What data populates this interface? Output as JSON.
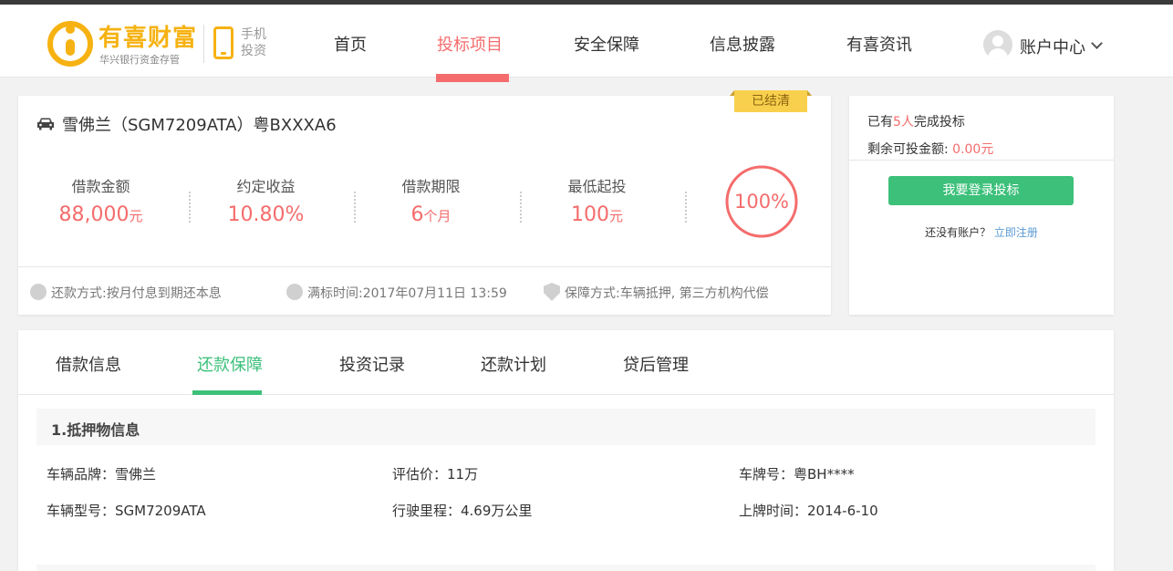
{
  "header": {
    "logo_name": "有喜财富",
    "logo_sub": "华兴银行资金存管",
    "mobile_line1": "手机",
    "mobile_line2": "投资",
    "nav": [
      {
        "label": "首页"
      },
      {
        "label": "投标项目"
      },
      {
        "label": "安全保障"
      },
      {
        "label": "信息披露"
      },
      {
        "label": "有喜资讯"
      }
    ],
    "account_label": "账户中心"
  },
  "project": {
    "title": "雪佛兰（SGM7209ATA）粤BXXXA6",
    "status": "已结清",
    "stats": [
      {
        "label": "借款金额",
        "value": "88,000",
        "unit": "元"
      },
      {
        "label": "约定收益",
        "value": "10.80%",
        "unit": ""
      },
      {
        "label": "借款期限",
        "value": "6",
        "unit": "个月"
      },
      {
        "label": "最低起投",
        "value": "100",
        "unit": "元"
      }
    ],
    "progress_text": "100%",
    "progress_fraction": 1.0,
    "footer": {
      "repay_method": "还款方式:按月付息到期还本息",
      "full_time": "满标时间:2017年07月11日 13:59",
      "guarantee": "保障方式:车辆抵押, 第三方机构代偿"
    }
  },
  "side": {
    "investors_prefix": "已有",
    "investors_count": "5人",
    "investors_suffix": "完成投标",
    "remaining_label": "剩余可投金额:",
    "remaining_value": "0.00元",
    "login_button": "我要登录投标",
    "no_account": "还没有账户？",
    "register_link": "立即注册"
  },
  "tabs": [
    {
      "label": "借款信息"
    },
    {
      "label": "还款保障"
    },
    {
      "label": "投资记录"
    },
    {
      "label": "还款计划"
    },
    {
      "label": "贷后管理"
    }
  ],
  "collateral": {
    "section_title": "1.抵押物信息",
    "brand": "车辆品牌：雪佛兰",
    "valuation": "评估价：11万",
    "plate": "车牌号：粤BH****",
    "model": "车辆型号：SGM7209ATA",
    "mileage": "行驶里程：4.69万公里",
    "register_date": "上牌时间：2014-6-10"
  },
  "colors": {
    "brand_yellow": "#f6b212",
    "accent_red": "#f56c6c",
    "accent_green": "#3cc07a",
    "status_ribbon": "#f8d04d"
  }
}
